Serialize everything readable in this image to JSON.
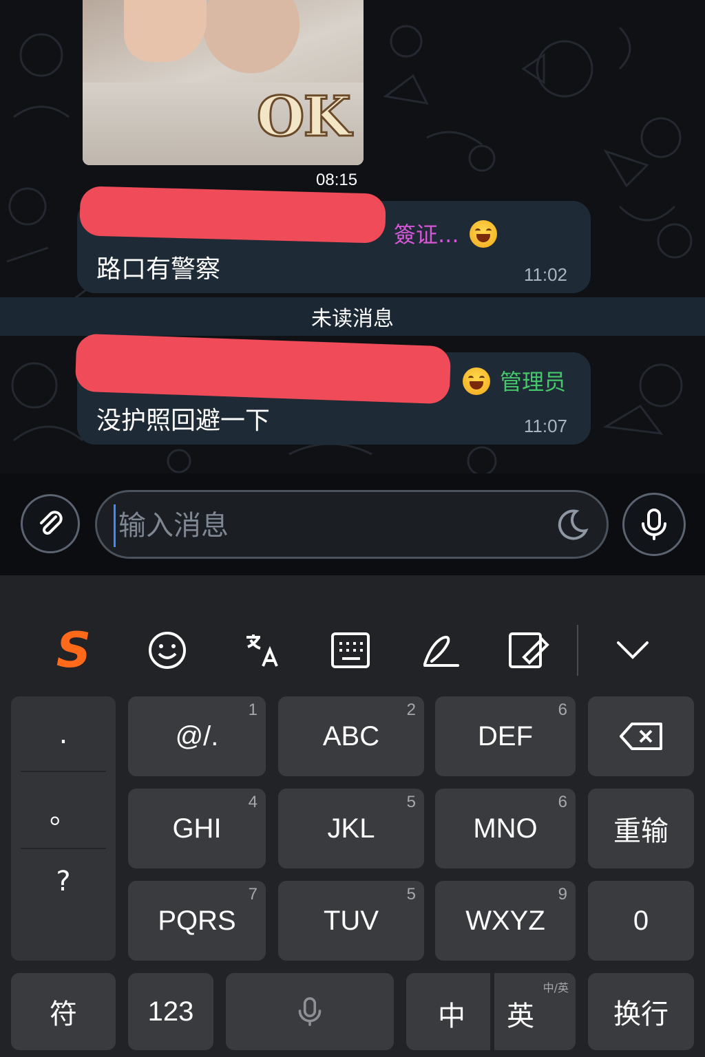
{
  "chat": {
    "photo": {
      "caption": "OK",
      "time": "08:15"
    },
    "messages": [
      {
        "sender_tag": "簽证...",
        "sender_color": "#d657d6",
        "text": "路口有警察",
        "time": "11:02"
      },
      {
        "sender_tag": "管理员",
        "sender_color": "#47c76b",
        "text": "没护照回避一下",
        "time": "11:07"
      }
    ],
    "unread_divider": "未读消息"
  },
  "input_bar": {
    "placeholder": "输入消息",
    "attach_icon": "paperclip-icon",
    "sticker_icon": "moon-icon",
    "voice_icon": "microphone-icon"
  },
  "keyboard": {
    "toolbar": {
      "logo": "S",
      "logo_color": "#ff6a1a",
      "icons": [
        "emoji-icon",
        "translate-icon",
        "keyboard-icon",
        "handwriting-icon",
        "edit-icon",
        "collapse-icon"
      ]
    },
    "punctuation": [
      ".",
      "。",
      "?"
    ],
    "keys": [
      {
        "label": "@/.",
        "num": "1"
      },
      {
        "label": "ABC",
        "num": "2"
      },
      {
        "label": "DEF",
        "num": "6"
      },
      {
        "label": "GHI",
        "num": "4"
      },
      {
        "label": "JKL",
        "num": "5"
      },
      {
        "label": "MNO",
        "num": "6"
      },
      {
        "label": "PQRS",
        "num": "7"
      },
      {
        "label": "TUV",
        "num": "5"
      },
      {
        "label": "WXYZ",
        "num": "9"
      }
    ],
    "backspace_icon": "backspace-icon",
    "reinput": "重输",
    "zero": "0",
    "bottom": {
      "symbols": "符",
      "numbers": "123",
      "space_icon": "microphone-icon",
      "chinese": "中",
      "english": "英",
      "english_sup": "中/英",
      "enter": "换行"
    }
  }
}
